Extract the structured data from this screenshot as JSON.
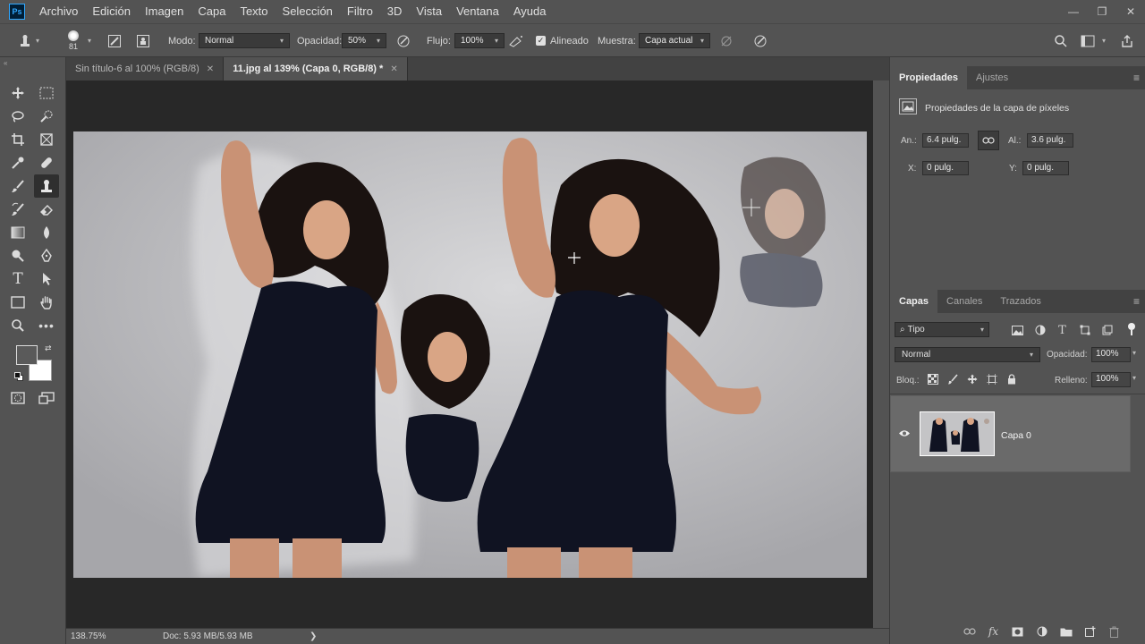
{
  "menu": {
    "logo": "Ps",
    "items": [
      "Archivo",
      "Edición",
      "Imagen",
      "Capa",
      "Texto",
      "Selección",
      "Filtro",
      "3D",
      "Vista",
      "Ventana",
      "Ayuda"
    ]
  },
  "options": {
    "brush_size": "81",
    "mode_label": "Modo:",
    "mode_value": "Normal",
    "opacity_label": "Opacidad:",
    "opacity_value": "50%",
    "flow_label": "Flujo:",
    "flow_value": "100%",
    "aligned_label": "Alineado",
    "sample_label": "Muestra:",
    "sample_value": "Capa actual"
  },
  "tabs": [
    {
      "label": "Sin título-6 al 100% (RGB/8)"
    },
    {
      "label": "11.jpg al 139% (Capa 0, RGB/8) *"
    }
  ],
  "status": {
    "zoom": "138.75%",
    "doc": "Doc: 5.93 MB/5.93 MB",
    "arrow": "❯"
  },
  "properties": {
    "tab_properties": "Propiedades",
    "tab_adjustments": "Ajustes",
    "heading": "Propiedades de la capa de píxeles",
    "width_label": "An.:",
    "width_value": "6.4 pulg.",
    "height_label": "Al.:",
    "height_value": "3.6 pulg.",
    "x_label": "X:",
    "x_value": "0 pulg.",
    "y_label": "Y:",
    "y_value": "0 pulg."
  },
  "layers": {
    "tab_layers": "Capas",
    "tab_channels": "Canales",
    "tab_paths": "Trazados",
    "filter_value": "Tipo",
    "blend_mode": "Normal",
    "opacity_label": "Opacidad:",
    "opacity_value": "100%",
    "lock_label": "Bloq.:",
    "fill_label": "Relleno:",
    "fill_value": "100%",
    "layer_name": "Capa 0"
  }
}
